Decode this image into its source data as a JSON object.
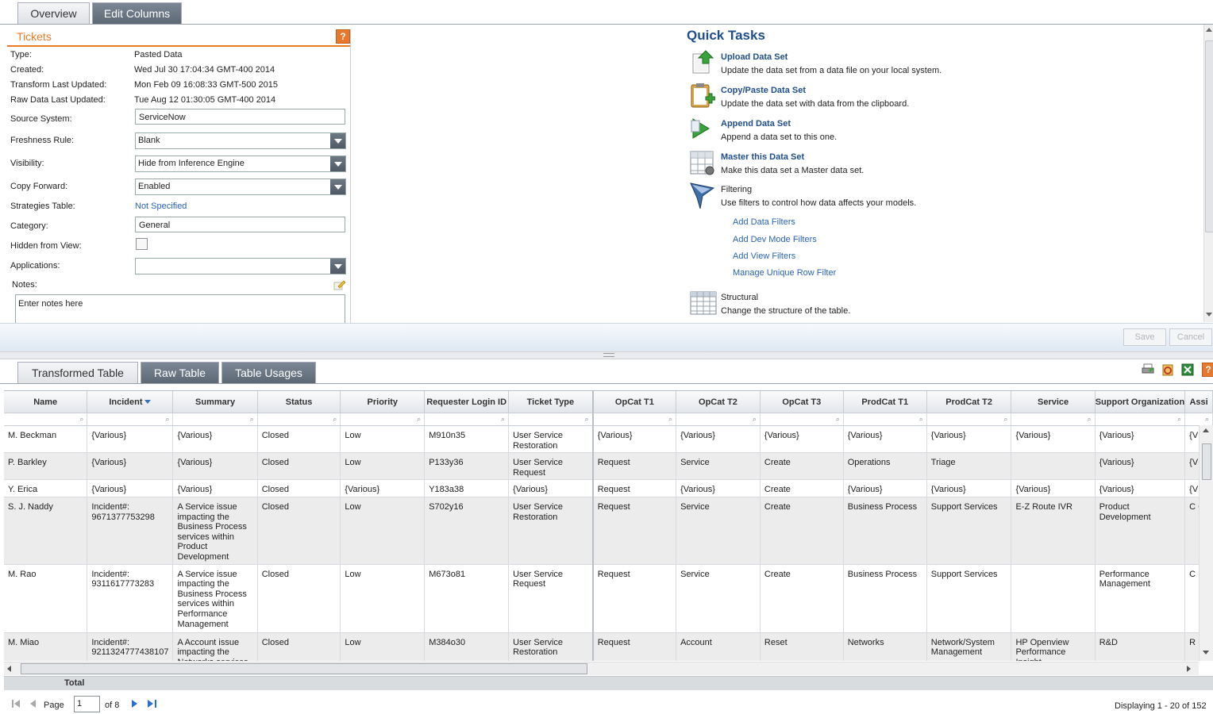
{
  "top_tabs": [
    "Overview",
    "Edit Columns"
  ],
  "tickets": {
    "title": "Tickets",
    "help": "?",
    "fields": [
      {
        "label": "Type:",
        "value": "Pasted Data"
      },
      {
        "label": "Created:",
        "value": "Wed Jul 30 17:04:34 GMT-400 2014"
      },
      {
        "label": "Transform Last Updated:",
        "value": "Mon Feb 09 16:08:33 GMT-500 2015"
      },
      {
        "label": "Raw Data Last Updated:",
        "value": "Tue Aug 12 01:30:05 GMT-400 2014"
      }
    ],
    "source_system": {
      "label": "Source System:",
      "value": "ServiceNow"
    },
    "freshness_rule": {
      "label": "Freshness Rule:",
      "value": "Blank"
    },
    "visibility": {
      "label": "Visibility:",
      "value": "Hide from Inference Engine"
    },
    "copy_forward": {
      "label": "Copy Forward:",
      "value": "Enabled"
    },
    "strategies_table": {
      "label": "Strategies Table:",
      "value": "Not Specified"
    },
    "category": {
      "label": "Category:",
      "value": "General"
    },
    "hidden_from_view": {
      "label": "Hidden from View:",
      "checked": false
    },
    "applications": {
      "label": "Applications:",
      "value": ""
    },
    "notes": {
      "label": "Notes:",
      "value": "Enter notes here"
    }
  },
  "quick_tasks": {
    "title": "Quick Tasks",
    "items": [
      {
        "title": "Upload Data Set",
        "desc": "Update the data set from a data file on your local system.",
        "icon": "upload-icon"
      },
      {
        "title": "Copy/Paste Data Set",
        "desc": "Update the data set with data from the clipboard.",
        "icon": "clipboard-icon"
      },
      {
        "title": "Append Data Set",
        "desc": "Append a data set to this one.",
        "icon": "append-icon"
      },
      {
        "title": "Master this Data Set",
        "desc": "Make this data set a Master data set.",
        "icon": "master-icon"
      },
      {
        "title": "Filtering",
        "desc": "Use filters to control how data affects your models.",
        "icon": "filter-icon"
      },
      {
        "title": "Structural",
        "desc": "Change the structure of the table.",
        "icon": "table-icon"
      }
    ],
    "filter_links": [
      "Add Data Filters",
      "Add Dev Mode Filters",
      "Add View Filters",
      "Manage Unique Row Filter"
    ]
  },
  "buttons": {
    "save": "Save",
    "cancel": "Cancel"
  },
  "bottom_tabs": [
    "Transformed Table",
    "Raw Table",
    "Table Usages"
  ],
  "toolbar_icons": [
    "print-icon",
    "refresh-icon",
    "excel-icon",
    "help-icon"
  ],
  "grid": {
    "columns": [
      "Name",
      "Incident",
      "Summary",
      "Status",
      "Priority",
      "Requester Login ID",
      "Ticket Type",
      "OpCat T1",
      "OpCat T2",
      "OpCat T3",
      "ProdCat T1",
      "ProdCat T2",
      "Service",
      "Support Organization",
      "Assi"
    ],
    "rows": [
      [
        "M. Beckman",
        "{Various}",
        "{Various}",
        "Closed",
        "Low",
        "M910n35",
        "User Service Restoration",
        "{Various}",
        "{Various}",
        "{Various}",
        "{Various}",
        "{Various}",
        "{Various}",
        "{Various}",
        "{V"
      ],
      [
        "P. Barkley",
        "{Various}",
        "{Various}",
        "Closed",
        "Low",
        "P133y36",
        "User Service Request",
        "Request",
        "Service",
        "Create",
        "Operations",
        "Triage",
        "",
        "{Various}",
        "{V"
      ],
      [
        "Y. Erica",
        "{Various}",
        "{Various}",
        "Closed",
        "{Various}",
        "Y183a38",
        "{Various}",
        "Request",
        "{Various}",
        "Create",
        "{Various}",
        "{Various}",
        "{Various}",
        "{Various}",
        "{V"
      ],
      [
        "S. J. Naddy",
        "Incident#: 9671377753298",
        "A Service issue impacting the Business Process services within Product Development",
        "Closed",
        "Low",
        "S702y16",
        "User Service Restoration",
        "Request",
        "Service",
        "Create",
        "Business Process",
        "Support Services",
        "E-Z Route IVR",
        "Product Development",
        "C C"
      ],
      [
        "M. Rao",
        "Incident#: 9311617773283",
        "A Service issue impacting the Business Process services within Performance Management",
        "Closed",
        "Low",
        "M673o81",
        "User Service Request",
        "Request",
        "Service",
        "Create",
        "Business Process",
        "Support Services",
        "",
        "Performance Management",
        "C Er"
      ],
      [
        "M. Miao",
        "Incident#: 9211324777438107",
        "A Account issue impacting the Networks services",
        "Closed",
        "Low",
        "M384o30",
        "User Service Restoration",
        "Request",
        "Account",
        "Reset",
        "Networks",
        "Network/System Management",
        "HP Openview Performance Insight",
        "R&D",
        "R"
      ]
    ]
  },
  "total_label": "Total",
  "pager": {
    "page_label": "Page",
    "page_value": "1",
    "of_label": "of 8",
    "display": "Displaying 1 - 20 of 152"
  }
}
